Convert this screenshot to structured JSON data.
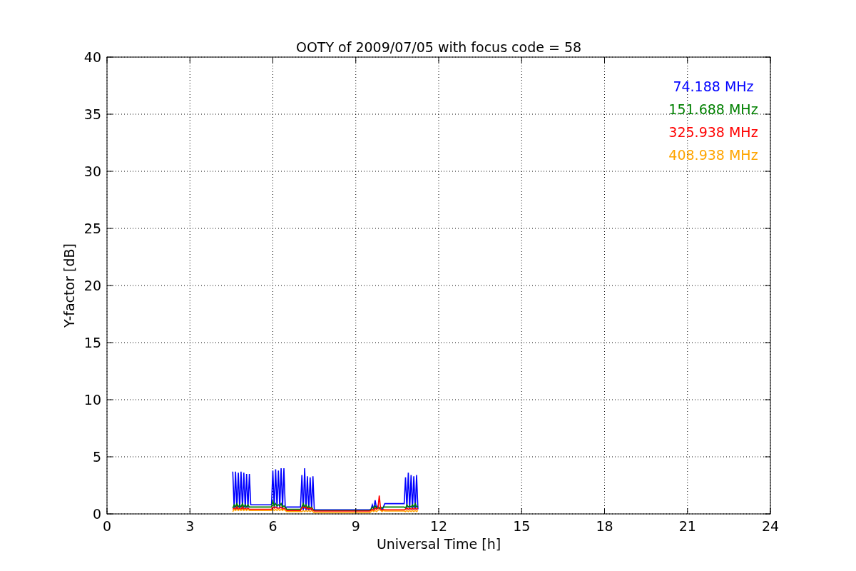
{
  "figure": {
    "chart_data": {
      "type": "line",
      "title": "OOTY of 2009/07/05 with focus code = 58",
      "xlabel": "Universal Time [h]",
      "ylabel": "Y-factor [dB]",
      "x": [
        4.55,
        4.6,
        4.65,
        4.7,
        4.75,
        4.8,
        4.85,
        4.9,
        4.95,
        5.0,
        5.05,
        5.1,
        5.15,
        5.2,
        5.95,
        6.0,
        6.05,
        6.1,
        6.15,
        6.2,
        6.25,
        6.3,
        6.35,
        6.4,
        6.45,
        6.5,
        7.0,
        7.05,
        7.1,
        7.15,
        7.2,
        7.25,
        7.3,
        7.35,
        7.4,
        7.45,
        7.5,
        9.5,
        9.55,
        9.6,
        9.65,
        9.7,
        9.75,
        9.8,
        9.85,
        9.9,
        9.95,
        10.0,
        10.05,
        10.75,
        10.8,
        10.85,
        10.9,
        10.95,
        11.0,
        11.05,
        11.1,
        11.15,
        11.2,
        11.25
      ],
      "series": [
        {
          "name": "74.188 MHz",
          "color": "#0000ff",
          "values": [
            3.7,
            0.4,
            3.7,
            0.4,
            3.6,
            0.4,
            3.7,
            0.4,
            3.6,
            0.4,
            3.5,
            0.4,
            3.5,
            0.8,
            0.8,
            3.8,
            0.5,
            3.9,
            0.5,
            3.8,
            0.5,
            4.0,
            0.5,
            4.0,
            0.5,
            0.6,
            0.6,
            3.4,
            0.3,
            4.0,
            0.3,
            3.3,
            0.3,
            3.2,
            0.3,
            3.3,
            0.35,
            0.35,
            0.4,
            0.8,
            0.4,
            1.2,
            0.5,
            0.7,
            0.4,
            0.5,
            0.3,
            0.6,
            0.9,
            0.9,
            3.2,
            0.4,
            3.6,
            0.4,
            3.4,
            0.4,
            3.3,
            0.4,
            3.4,
            0.4
          ]
        },
        {
          "name": "151.688 MHz",
          "color": "#008000",
          "values": [
            0.5,
            0.8,
            0.6,
            0.9,
            0.6,
            0.8,
            0.6,
            0.9,
            0.6,
            0.8,
            0.6,
            0.8,
            0.6,
            0.6,
            0.6,
            1.1,
            0.7,
            0.9,
            0.7,
            0.8,
            0.7,
            0.9,
            0.6,
            0.7,
            0.6,
            0.4,
            0.4,
            0.6,
            0.9,
            0.6,
            0.8,
            0.5,
            0.7,
            0.5,
            0.6,
            0.4,
            0.3,
            0.3,
            0.4,
            0.6,
            0.5,
            0.7,
            0.5,
            0.6,
            0.5,
            0.6,
            0.5,
            0.6,
            0.6,
            0.6,
            0.5,
            0.8,
            0.6,
            0.7,
            0.6,
            0.8,
            0.6,
            0.9,
            0.6,
            0.7
          ]
        },
        {
          "name": "325.938 MHz",
          "color": "#ff0000",
          "values": [
            0.4,
            0.5,
            0.4,
            0.6,
            0.4,
            0.5,
            0.4,
            0.6,
            0.4,
            0.5,
            0.4,
            0.5,
            0.4,
            0.4,
            0.4,
            0.6,
            0.5,
            0.6,
            0.5,
            0.5,
            0.5,
            0.6,
            0.4,
            0.5,
            0.4,
            0.3,
            0.3,
            0.5,
            0.6,
            0.5,
            0.6,
            0.4,
            0.5,
            0.4,
            0.5,
            0.3,
            0.25,
            0.25,
            0.3,
            0.4,
            0.3,
            0.5,
            0.4,
            0.5,
            1.6,
            0.4,
            0.3,
            0.4,
            0.35,
            0.35,
            0.4,
            0.5,
            0.4,
            0.5,
            0.4,
            0.5,
            0.4,
            0.5,
            0.4,
            0.5
          ]
        },
        {
          "name": "408.938 MHz",
          "color": "#ffa500",
          "values": [
            0.2,
            0.4,
            0.3,
            0.4,
            0.3,
            0.4,
            0.3,
            0.4,
            0.3,
            0.4,
            0.3,
            0.4,
            0.3,
            0.3,
            0.3,
            0.4,
            0.3,
            0.4,
            0.3,
            0.4,
            0.3,
            0.4,
            0.3,
            0.4,
            0.3,
            0.2,
            0.2,
            0.2,
            0.3,
            0.2,
            0.3,
            0.2,
            0.3,
            0.2,
            0.3,
            0.2,
            0.1,
            0.1,
            0.2,
            0.3,
            0.2,
            0.3,
            0.2,
            0.3,
            0.4,
            0.3,
            0.2,
            0.3,
            0.25,
            0.25,
            0.2,
            0.3,
            0.2,
            0.3,
            0.2,
            0.3,
            0.2,
            0.3,
            0.2,
            0.3
          ]
        }
      ],
      "xlim": [
        0,
        24
      ],
      "ylim": [
        0,
        40
      ],
      "xticks": [
        0,
        3,
        6,
        9,
        12,
        15,
        18,
        21,
        24
      ],
      "yticks": [
        0,
        5,
        10,
        15,
        20,
        25,
        30,
        35,
        40
      ],
      "grid": true
    }
  }
}
